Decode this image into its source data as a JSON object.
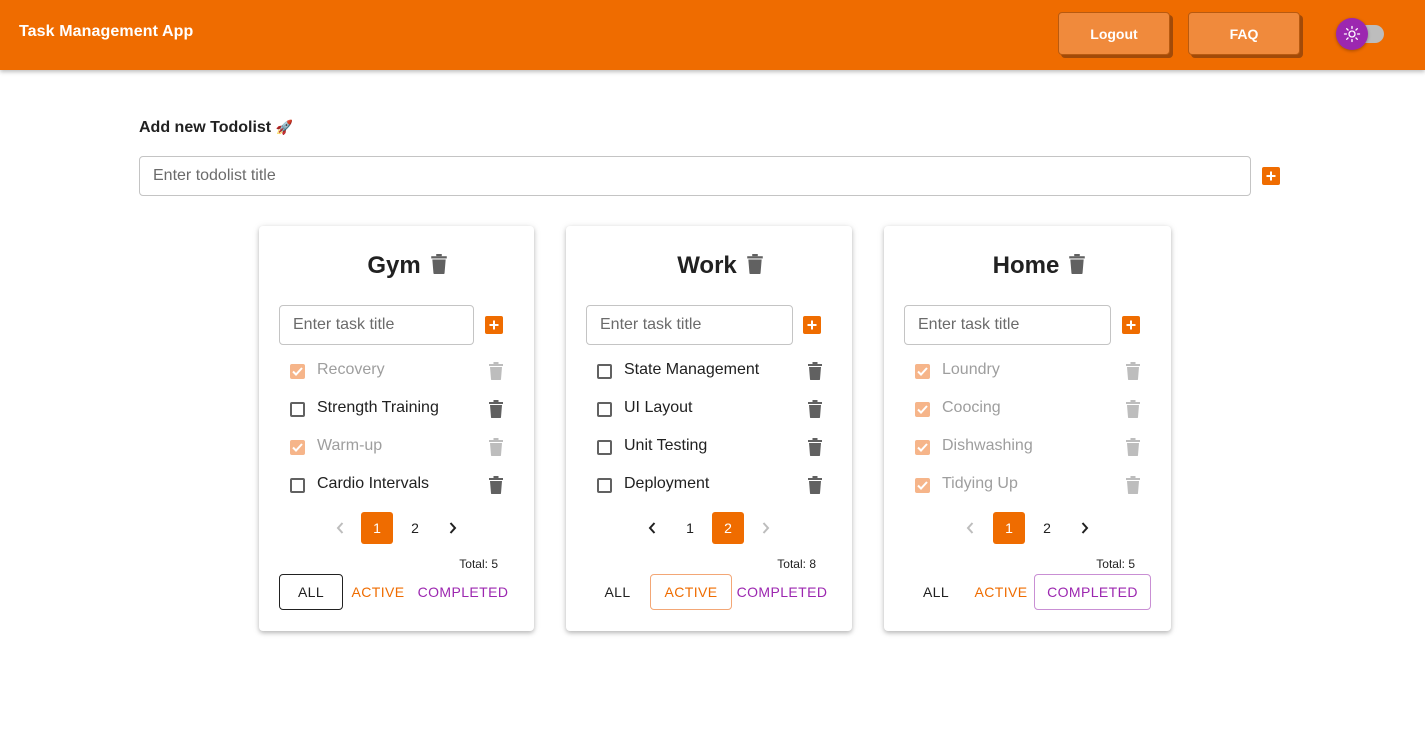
{
  "app": {
    "title": "Task Management App",
    "logout_label": "Logout",
    "faq_label": "FAQ",
    "theme_toggle_icon": "sun-icon"
  },
  "add_todolist": {
    "heading": "Add new Todolist",
    "emoji": "🚀",
    "placeholder": "Enter todolist title"
  },
  "colors": {
    "accent": "#ef6c00",
    "purple": "#9c27b0"
  },
  "todolists": [
    {
      "title": "Gym",
      "task_placeholder": "Enter task title",
      "tasks": [
        {
          "title": "Recovery",
          "done": true
        },
        {
          "title": "Strength Training",
          "done": false
        },
        {
          "title": "Warm-up",
          "done": true
        },
        {
          "title": "Cardio Intervals",
          "done": false
        }
      ],
      "pages": [
        "1",
        "2"
      ],
      "current_page": 1,
      "total": "Total: 5",
      "filters": {
        "all": "ALL",
        "active": "ACTIVE",
        "completed": "COMPLETED"
      },
      "selected_filter": "all"
    },
    {
      "title": "Work",
      "task_placeholder": "Enter task title",
      "tasks": [
        {
          "title": "State Management",
          "done": false
        },
        {
          "title": "UI Layout",
          "done": false
        },
        {
          "title": "Unit Testing",
          "done": false
        },
        {
          "title": "Deployment",
          "done": false
        }
      ],
      "pages": [
        "1",
        "2"
      ],
      "current_page": 2,
      "total": "Total: 8",
      "filters": {
        "all": "ALL",
        "active": "ACTIVE",
        "completed": "COMPLETED"
      },
      "selected_filter": "active"
    },
    {
      "title": "Home",
      "task_placeholder": "Enter task title",
      "tasks": [
        {
          "title": "Loundry",
          "done": true
        },
        {
          "title": "Coocing",
          "done": true
        },
        {
          "title": "Dishwashing",
          "done": true
        },
        {
          "title": "Tidying Up",
          "done": true
        }
      ],
      "pages": [
        "1",
        "2"
      ],
      "current_page": 1,
      "total": "Total: 5",
      "filters": {
        "all": "ALL",
        "active": "ACTIVE",
        "completed": "COMPLETED"
      },
      "selected_filter": "completed"
    }
  ]
}
